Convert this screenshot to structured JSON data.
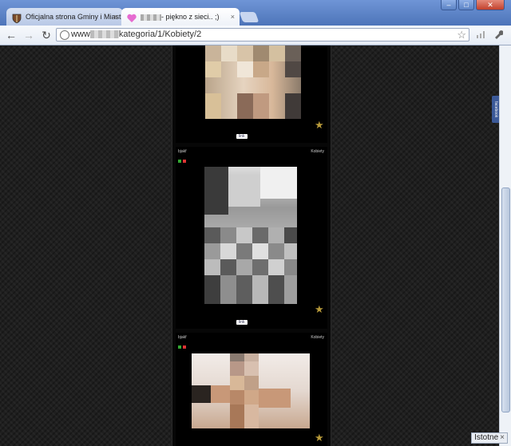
{
  "browser": {
    "tabs": [
      {
        "label": "Oficjalna strona Gminy i Miast",
        "active": false
      },
      {
        "label": "- piękno z sieci.. ;)",
        "active": true
      }
    ],
    "url_prefix": "www",
    "url_suffix": "kategoria/1/Kobiety/2",
    "window_buttons": {
      "minimize": "–",
      "maximize": "□",
      "close": "✕"
    }
  },
  "posts": [
    {
      "author": "",
      "category": "",
      "link_label": "link"
    },
    {
      "author": "bjakf",
      "category": "Kobiety",
      "link_label": "link"
    },
    {
      "author": "bjakf",
      "category": "Kobiety",
      "link_label": ""
    }
  ],
  "facebook_tab": "facebook",
  "bottom_badge": {
    "label": "Istotne",
    "close": "×"
  },
  "colors": {
    "frame": "#5a7fbf",
    "page_bg": "#1f1f1f",
    "column_bg": "#070707"
  }
}
